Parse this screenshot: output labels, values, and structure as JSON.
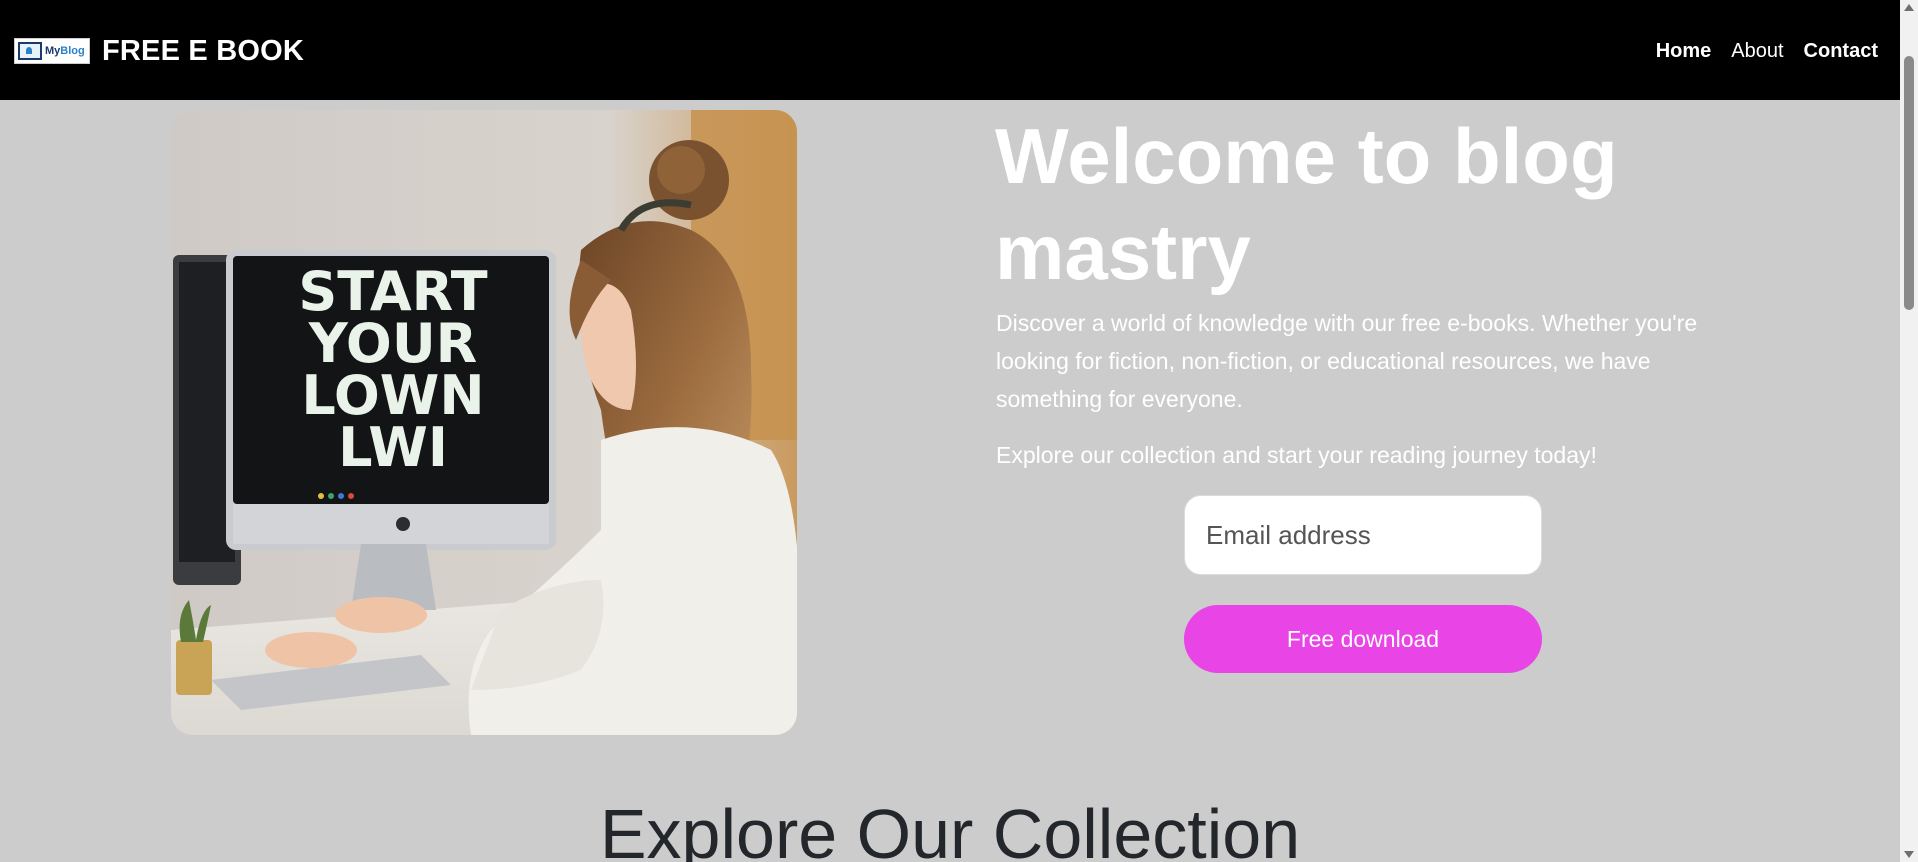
{
  "header": {
    "logo": {
      "text_prefix": "My",
      "text_accent": "Blog",
      "icon": "monitor-icon"
    },
    "brand_title": "FREE E BOOK",
    "nav": [
      {
        "label": "Home"
      },
      {
        "label": "About"
      },
      {
        "label": "Contact"
      }
    ]
  },
  "hero": {
    "image": {
      "screen_text": [
        "START",
        "YOUR",
        "LOWN",
        "LWI"
      ]
    },
    "heading": "Welcome to blog mastry",
    "description": "Discover a world of knowledge with our free e-books. Whether you're looking for fiction, non-fiction, or educational resources, we have something for everyone.",
    "cta_text": "Explore our collection and start your reading journey today!",
    "email": {
      "placeholder": "Email address",
      "value": ""
    },
    "download_label": "Free download"
  },
  "collection": {
    "heading": "Explore Our Collection"
  },
  "colors": {
    "page_background": "#cccccc",
    "header_background": "#000000",
    "accent_button": "#e945e6",
    "hero_text": "#ffffff",
    "section_heading": "#23262b"
  }
}
